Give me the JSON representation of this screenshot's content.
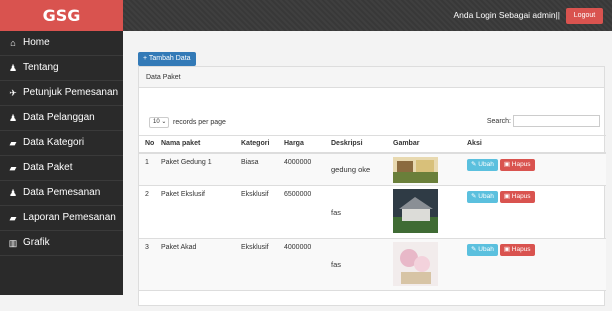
{
  "sidebar": {
    "brand": "GSG",
    "items": [
      {
        "icon": "home-icon",
        "glyph": "⌂",
        "label": "Home"
      },
      {
        "icon": "user-icon",
        "glyph": "♟",
        "label": "Tentang"
      },
      {
        "icon": "rocket-icon",
        "glyph": "✈",
        "label": "Petunjuk Pemesanan"
      },
      {
        "icon": "user-icon",
        "glyph": "♟",
        "label": "Data Pelanggan"
      },
      {
        "icon": "folder-icon",
        "glyph": "▰",
        "label": "Data Kategori"
      },
      {
        "icon": "folder-icon",
        "glyph": "▰",
        "label": "Data Paket"
      },
      {
        "icon": "user-icon",
        "glyph": "♟",
        "label": "Data Pemesanan"
      },
      {
        "icon": "folder-icon",
        "glyph": "▰",
        "label": "Laporan Pemesanan"
      },
      {
        "icon": "chart-icon",
        "glyph": "▥",
        "label": "Grafik"
      }
    ]
  },
  "topbar": {
    "login_text": "Anda Login Sebagai admin||",
    "logout_label": "Logout"
  },
  "main": {
    "add_button": "+ Tambah Data",
    "panel_title": "Data Paket",
    "entries_value": "10",
    "entries_label": "records per page",
    "search_label": "Search:"
  },
  "table": {
    "headers": [
      "No",
      "Nama paket",
      "Kategori",
      "Harga",
      "Deskripsi",
      "Gambar",
      "Aksi"
    ],
    "rows": [
      {
        "no": "1",
        "nama": "Paket Gedung 1",
        "kategori": "Biasa",
        "harga": "4000000",
        "deskripsi": "gedung oke"
      },
      {
        "no": "2",
        "nama": "Paket Ekslusif",
        "kategori": "Eksklusif",
        "harga": "6500000",
        "deskripsi": "fas"
      },
      {
        "no": "3",
        "nama": "Paket Akad",
        "kategori": "Eksklusif",
        "harga": "4000000",
        "deskripsi": "fas"
      }
    ],
    "edit_label": "Ubah",
    "delete_label": "Hapus"
  },
  "colors": {
    "brand": "#d9534f",
    "primary": "#337ab7",
    "info": "#5bc0de",
    "danger": "#d9534f",
    "sidebar_bg": "#2a2a2a"
  }
}
